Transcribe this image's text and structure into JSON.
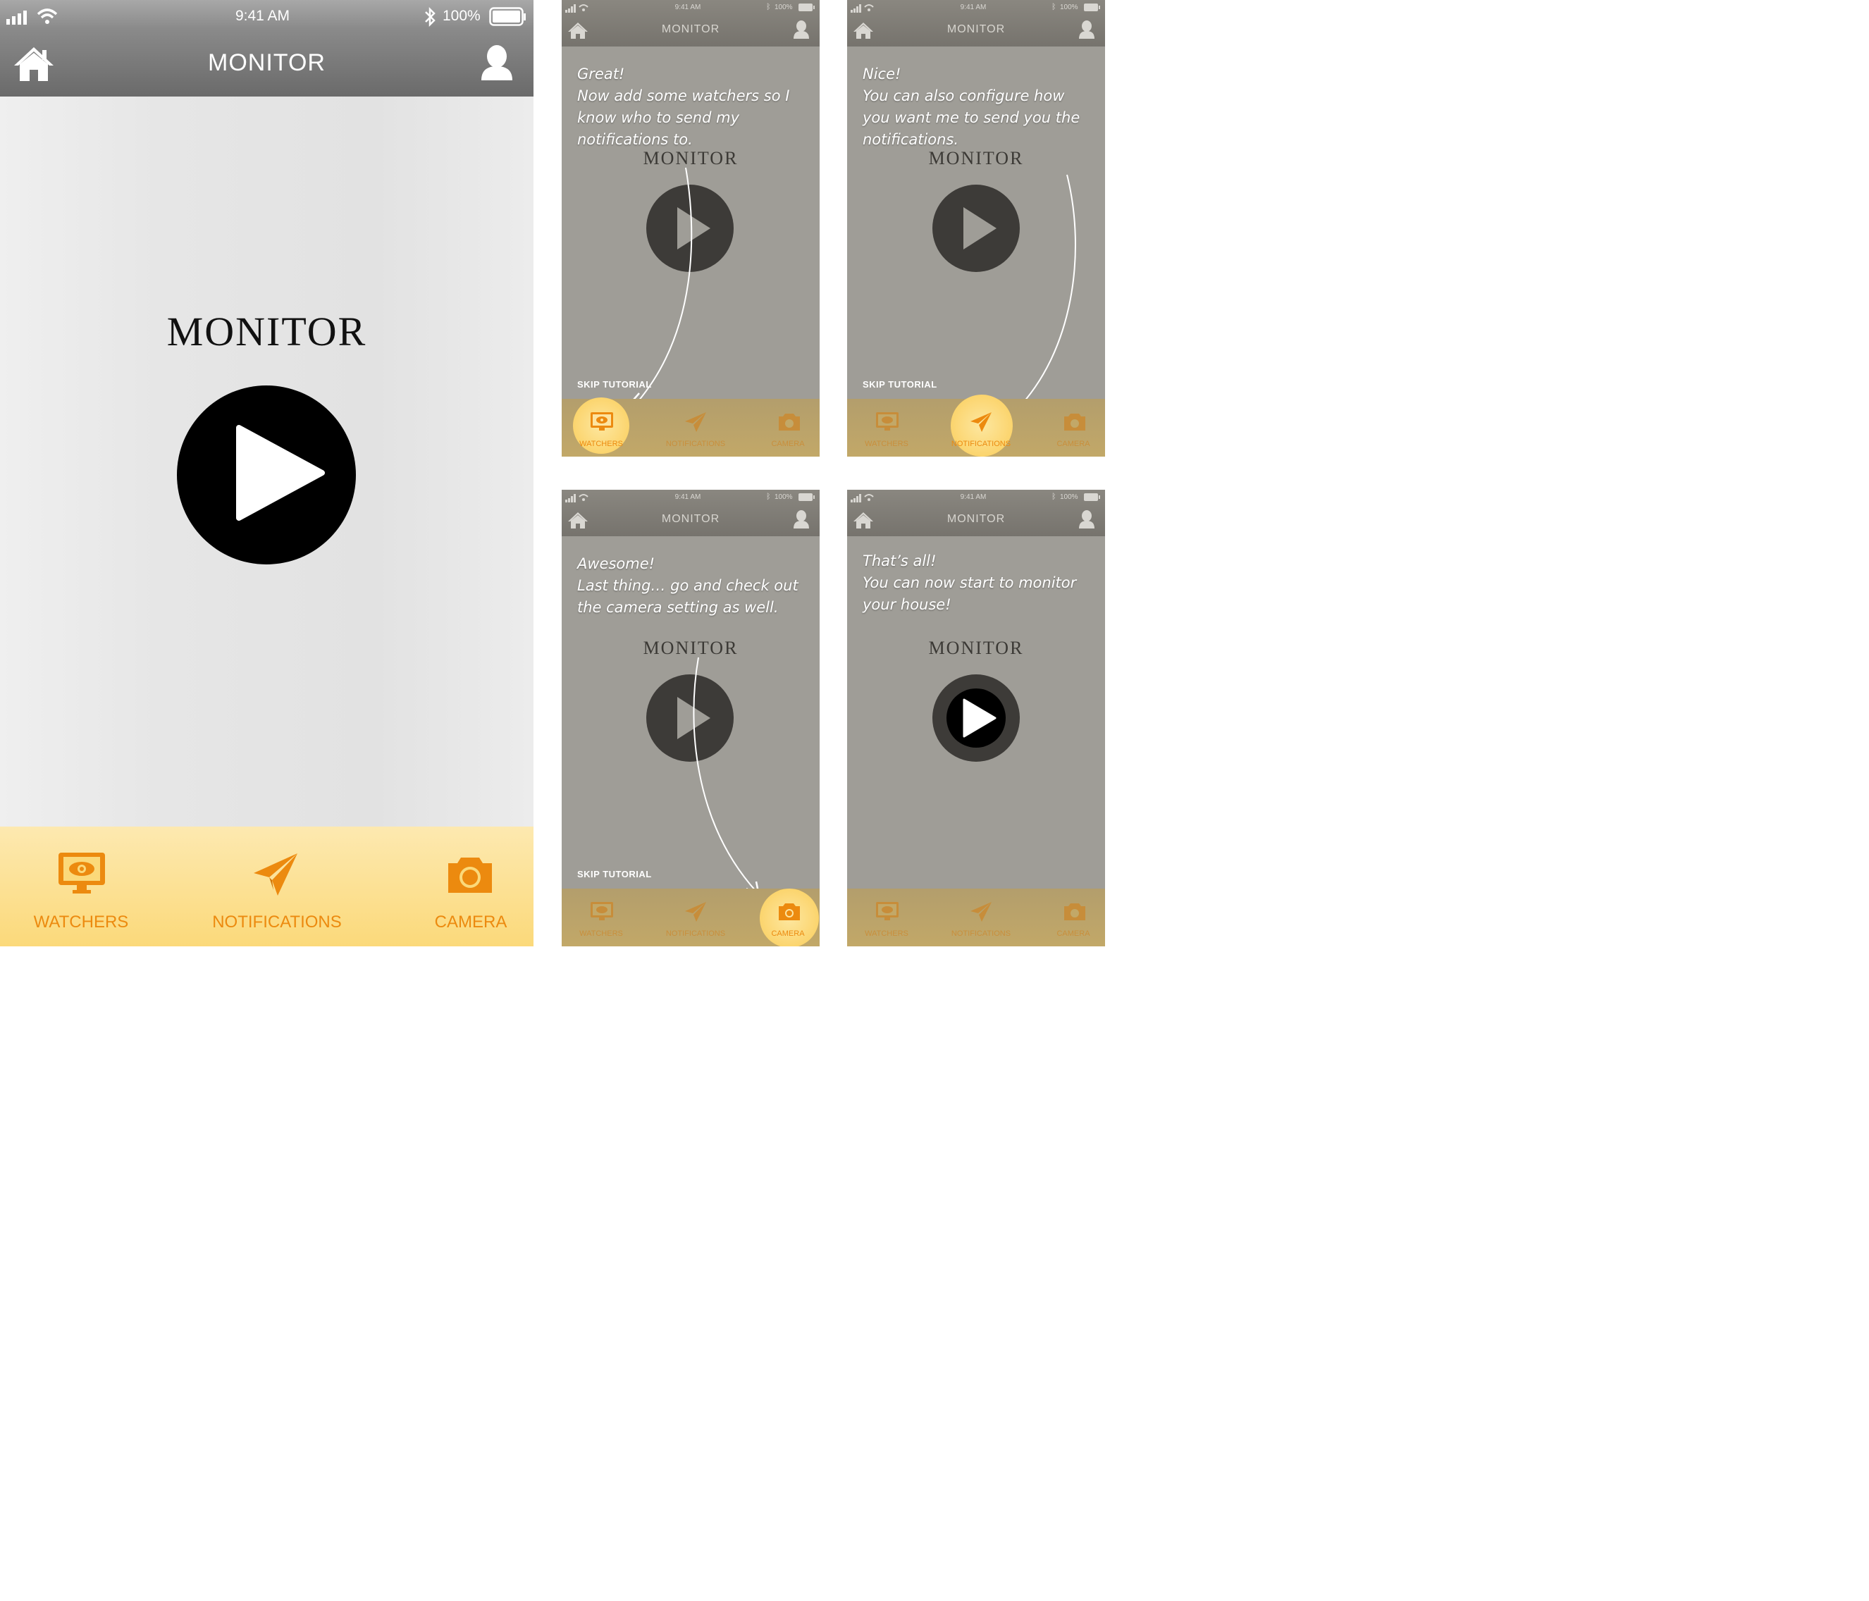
{
  "status_bar": {
    "time": "9:41 AM",
    "battery": "100%"
  },
  "nav": {
    "title": "MONITOR"
  },
  "main": {
    "wordmark": "MONITOR"
  },
  "tabs": [
    {
      "label": "WATCHERS",
      "icon": "monitor-eye-icon"
    },
    {
      "label": "NOTIFICATIONS",
      "icon": "paper-plane-icon"
    },
    {
      "label": "CAMERA",
      "icon": "camera-icon"
    }
  ],
  "tutorial": {
    "skip_label": "SKIP TUTORIAL",
    "steps": [
      {
        "lines": [
          "Great!",
          "Now add some watchers so I",
          "know who to send my",
          "notifications to."
        ]
      },
      {
        "lines": [
          "Nice!",
          "You can also configure how",
          "you want me to send you the",
          "notifications."
        ]
      },
      {
        "lines": [
          "Awesome!",
          "Last thing… go and check out",
          "the camera setting as well."
        ]
      },
      {
        "lines": [
          "That’s all!",
          "You can now start to monitor",
          "your house!"
        ]
      }
    ]
  },
  "colors": {
    "accent": "#ec8a0f",
    "tab_bg": "#fbd97a",
    "header": "#6f6f6f"
  }
}
